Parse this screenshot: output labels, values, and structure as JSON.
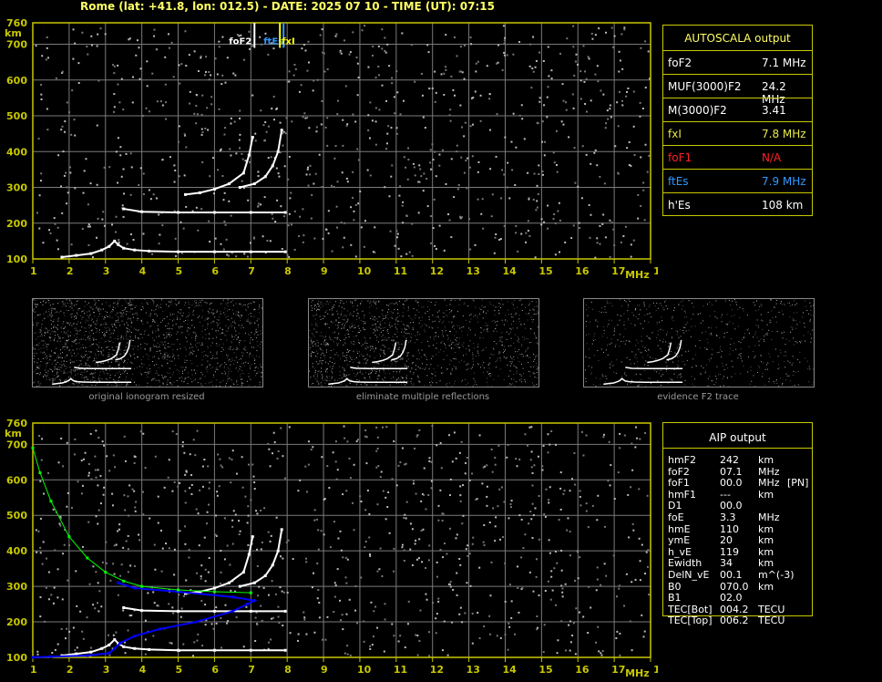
{
  "header": "Rome (lat: +41.8, lon: 012.5) - DATE: 2025 07 10 - TIME (UT): 07:15",
  "colors": {
    "frame": "#c8c800",
    "grid": "#7a7a7a",
    "trace": "#ffffff",
    "model": "#00ff00",
    "profile": "#0000ff",
    "fof2": "#ffffff",
    "ftes": "#3399ff",
    "fxi": "#ffff00",
    "na": "#ff3333"
  },
  "ionogram": {
    "y_unit": "km",
    "x_unit": "MHz",
    "x_ticks": [
      "1",
      "2",
      "3",
      "4",
      "5",
      "6",
      "7",
      "8",
      "9",
      "10",
      "11",
      "12",
      "13",
      "14",
      "15",
      "16",
      "17",
      "18"
    ],
    "y_ticks": [
      "760",
      "700",
      "600",
      "500",
      "400",
      "300",
      "200",
      "100"
    ],
    "markers": {
      "fof2": "foF2",
      "ftes": "ftEs",
      "fxi": "fxI"
    }
  },
  "chart_data": [
    {
      "type": "scatter",
      "title": "",
      "xlabel": "MHz",
      "ylabel": "km",
      "xlim": [
        1,
        18
      ],
      "ylim": [
        100,
        760
      ],
      "grid": true,
      "series": [
        {
          "role": "E/Es trace",
          "x": [
            1.8,
            2.2,
            2.6,
            2.9,
            3.1,
            3.25,
            3.35,
            3.5,
            3.8,
            4.2,
            5,
            6,
            7,
            7.95
          ],
          "y": [
            105,
            110,
            115,
            125,
            135,
            150,
            140,
            130,
            125,
            122,
            120,
            120,
            120,
            120
          ]
        },
        {
          "role": "multiple reflection",
          "x": [
            3.5,
            4,
            5,
            6,
            7,
            7.95
          ],
          "y": [
            240,
            232,
            230,
            230,
            230,
            230
          ]
        },
        {
          "role": "O trace",
          "x": [
            5.2,
            5.6,
            6,
            6.4,
            6.8,
            6.95,
            7.05
          ],
          "y": [
            280,
            285,
            295,
            310,
            340,
            390,
            440
          ]
        },
        {
          "role": "X trace",
          "x": [
            6.7,
            7.1,
            7.4,
            7.6,
            7.75,
            7.85
          ],
          "y": [
            300,
            310,
            330,
            360,
            400,
            460
          ]
        }
      ],
      "markers": [
        {
          "label": "foF2",
          "x": 7.1
        },
        {
          "label": "ftEs",
          "x": 7.9
        },
        {
          "label": "fxI",
          "x": 7.8
        }
      ]
    },
    {
      "type": "scatter",
      "title": "",
      "xlabel": "MHz",
      "ylabel": "km",
      "xlim": [
        1,
        18
      ],
      "ylim": [
        100,
        760
      ],
      "grid": true,
      "series": [
        {
          "role": "E/Es trace",
          "x": [
            1.8,
            2.2,
            2.6,
            2.9,
            3.1,
            3.25,
            3.35,
            3.5,
            3.8,
            4.2,
            5,
            6,
            7,
            7.95
          ],
          "y": [
            105,
            110,
            115,
            125,
            135,
            150,
            140,
            130,
            125,
            122,
            120,
            120,
            120,
            120
          ]
        },
        {
          "role": "multiple reflection",
          "x": [
            3.5,
            4,
            5,
            6,
            7,
            7.95
          ],
          "y": [
            240,
            232,
            230,
            230,
            230,
            230
          ]
        },
        {
          "role": "O trace",
          "x": [
            5.2,
            5.6,
            6,
            6.4,
            6.8,
            6.95,
            7.05
          ],
          "y": [
            280,
            285,
            295,
            310,
            340,
            390,
            440
          ]
        },
        {
          "role": "X trace",
          "x": [
            6.7,
            7.1,
            7.4,
            7.6,
            7.75,
            7.85
          ],
          "y": [
            300,
            310,
            330,
            360,
            400,
            460
          ]
        },
        {
          "role": "electron density profile",
          "x": [
            1,
            1.5,
            2.5,
            3.1,
            3.25,
            3.4,
            3.8,
            4.5,
            5.5,
            6.5,
            6.9,
            7.1,
            6.5,
            5,
            3.8,
            3.35
          ],
          "y": [
            100,
            102,
            105,
            112,
            125,
            140,
            160,
            180,
            200,
            230,
            250,
            260,
            270,
            285,
            295,
            310
          ]
        },
        {
          "role": "virtual height model",
          "x": [
            1,
            1.2,
            1.5,
            2,
            2.5,
            3,
            3.5,
            4,
            5,
            6,
            7
          ],
          "y": [
            690,
            620,
            540,
            440,
            380,
            340,
            315,
            300,
            290,
            285,
            282
          ]
        }
      ]
    }
  ],
  "autoscala": {
    "title": "AUTOSCALA output",
    "rows": [
      {
        "label": "foF2",
        "value": "7.1 MHz",
        "color": "#ffffff"
      },
      {
        "label": "MUF(3000)F2",
        "value": "24.2 MHz",
        "color": "#ffffff"
      },
      {
        "label": "M(3000)F2",
        "value": "3.41",
        "color": "#ffffff"
      },
      {
        "label": "fxI",
        "value": "7.8 MHz",
        "color": "#e8e84a"
      },
      {
        "label": "foF1",
        "value": "N/A",
        "color": "#ff2020"
      },
      {
        "label": "ftEs",
        "value": "7.9 MHz",
        "color": "#3399ff"
      },
      {
        "label": "h'Es",
        "value": "108 km",
        "color": "#ffffff"
      }
    ]
  },
  "thumbnails": {
    "original": "original ionogram resized",
    "multiple": "eliminate multiple reflections",
    "f2": "evidence F2 trace"
  },
  "aip": {
    "title": "AIP output",
    "rows": [
      {
        "name": "hmF2",
        "value": "242",
        "unit": "km",
        "flag": ""
      },
      {
        "name": "foF2",
        "value": "07.1",
        "unit": "MHz",
        "flag": ""
      },
      {
        "name": "foF1",
        "value": "00.0",
        "unit": "MHz",
        "flag": "[PN]"
      },
      {
        "name": "hmF1",
        "value": "---",
        "unit": "km",
        "flag": ""
      },
      {
        "name": "D1",
        "value": "00.0",
        "unit": "",
        "flag": ""
      },
      {
        "name": "foE",
        "value": "3.3",
        "unit": "MHz",
        "flag": ""
      },
      {
        "name": "hmE",
        "value": "110",
        "unit": "km",
        "flag": ""
      },
      {
        "name": "ymE",
        "value": "20",
        "unit": "km",
        "flag": ""
      },
      {
        "name": "h_vE",
        "value": "119",
        "unit": "km",
        "flag": ""
      },
      {
        "name": "Ewidth",
        "value": "34",
        "unit": "km",
        "flag": ""
      },
      {
        "name": "DelN_vE",
        "value": "00.1",
        "unit": "m^(-3)",
        "flag": ""
      },
      {
        "name": "B0",
        "value": "070.0",
        "unit": "km",
        "flag": ""
      },
      {
        "name": "B1",
        "value": "02.0",
        "unit": "",
        "flag": ""
      },
      {
        "name": "TEC[Bot]",
        "value": "004.2",
        "unit": "TECU",
        "flag": ""
      },
      {
        "name": "TEC[Top]",
        "value": "006.2",
        "unit": "TECU",
        "flag": ""
      }
    ]
  }
}
